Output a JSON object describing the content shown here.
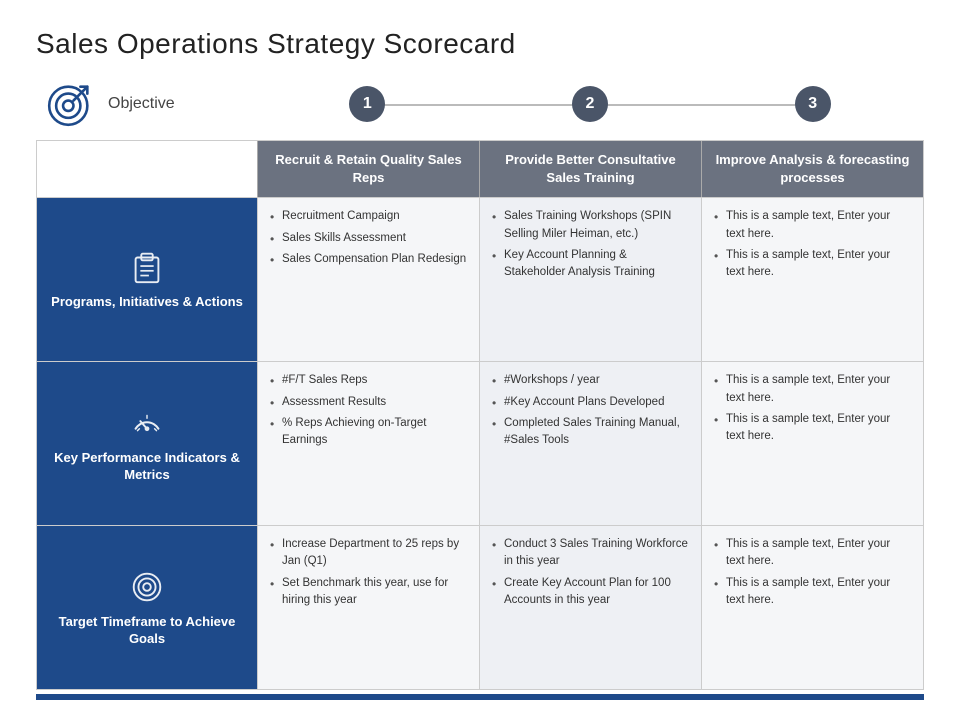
{
  "page": {
    "title": "Sales Operations Strategy Scorecard"
  },
  "header": {
    "objective_label": "Objective",
    "numbers": [
      "1",
      "2",
      "3"
    ]
  },
  "table": {
    "columns": [
      "Recruit & Retain Quality Sales Reps",
      "Provide Better Consultative Sales Training",
      "Improve Analysis & forecasting processes"
    ],
    "rows": [
      {
        "label": "Programs, Initiatives & Actions",
        "cells": [
          [
            "Recruitment Campaign",
            "Sales Skills Assessment",
            "Sales Compensation Plan Redesign"
          ],
          [
            "Sales Training Workshops (SPIN Selling Miler Heiman, etc.)",
            "Key Account Planning & Stakeholder Analysis Training"
          ],
          [
            "This is a sample text, Enter your text here.",
            "This is a sample text, Enter your text here."
          ]
        ]
      },
      {
        "label": "Key Performance Indicators & Metrics",
        "cells": [
          [
            "#F/T Sales Reps",
            "Assessment Results",
            "% Reps Achieving on-Target Earnings"
          ],
          [
            "#Workshops / year",
            "#Key Account Plans Developed",
            "Completed Sales Training Manual, #Sales Tools"
          ],
          [
            "This is a sample text, Enter your text here.",
            "This is a sample text, Enter your text here."
          ]
        ]
      },
      {
        "label": "Target Timeframe to Achieve Goals",
        "cells": [
          [
            "Increase Department to 25 reps by Jan (Q1)",
            "Set Benchmark this year, use for hiring this year"
          ],
          [
            "Conduct 3 Sales Training Workforce in this year",
            "Create Key Account Plan for 100 Accounts in this year"
          ],
          [
            "This is a sample text, Enter your text here.",
            "This is a sample text, Enter your text here."
          ]
        ]
      }
    ]
  },
  "icons": {
    "target": "target-icon",
    "programs": "clipboard-icon",
    "kpi": "gauge-icon",
    "timeframe": "bullseye-icon"
  }
}
